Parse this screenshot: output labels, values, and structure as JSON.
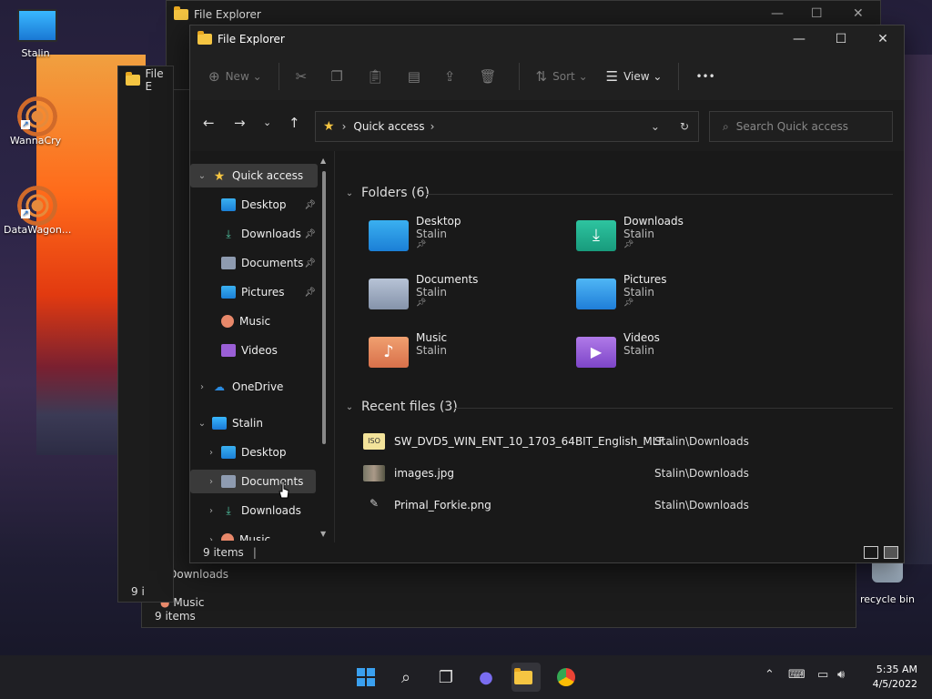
{
  "desktop": {
    "icons": [
      {
        "label": "Stalin"
      },
      {
        "label": "WannaCry"
      },
      {
        "label": "DataWagon..."
      },
      {
        "label": "recycle bin"
      }
    ]
  },
  "background_windows": {
    "title": "File Explorer",
    "title_short": "File E",
    "status": "9 items",
    "status_short": "9 i",
    "nav": [
      "Downloads",
      "Music"
    ]
  },
  "window": {
    "title": "File Explorer",
    "controls": {
      "minimize": "—",
      "maximize": "☐",
      "close": "✕"
    }
  },
  "commandbar": {
    "new": "New",
    "sort": "Sort",
    "view": "View",
    "more": "•••"
  },
  "address": {
    "location": "Quick access",
    "search_placeholder": "Search Quick access"
  },
  "sidebar": {
    "items": [
      {
        "label": "Quick access",
        "pinned": false
      },
      {
        "label": "Desktop",
        "pinned": true
      },
      {
        "label": "Downloads",
        "pinned": true
      },
      {
        "label": "Documents",
        "pinned": true
      },
      {
        "label": "Pictures",
        "pinned": true
      },
      {
        "label": "Music",
        "pinned": false
      },
      {
        "label": "Videos",
        "pinned": false
      },
      {
        "label": "OneDrive",
        "pinned": false
      },
      {
        "label": "Stalin",
        "pinned": false
      },
      {
        "label": "Desktop",
        "pinned": false
      },
      {
        "label": "Documents",
        "pinned": false
      },
      {
        "label": "Downloads",
        "pinned": false
      },
      {
        "label": "Music",
        "pinned": false
      }
    ]
  },
  "folders": {
    "heading": "Folders (6)",
    "items": [
      {
        "name": "Desktop",
        "owner": "Stalin",
        "pinned": true
      },
      {
        "name": "Downloads",
        "owner": "Stalin",
        "pinned": true
      },
      {
        "name": "Documents",
        "owner": "Stalin",
        "pinned": true
      },
      {
        "name": "Pictures",
        "owner": "Stalin",
        "pinned": true
      },
      {
        "name": "Music",
        "owner": "Stalin",
        "pinned": false
      },
      {
        "name": "Videos",
        "owner": "Stalin",
        "pinned": false
      }
    ]
  },
  "recent": {
    "heading": "Recent files (3)",
    "files": [
      {
        "name": "SW_DVD5_WIN_ENT_10_1703_64BIT_English_MLF...",
        "location": "Stalin\\Downloads"
      },
      {
        "name": "images.jpg",
        "location": "Stalin\\Downloads"
      },
      {
        "name": "Primal_Forkie.png",
        "location": "Stalin\\Downloads"
      }
    ]
  },
  "status": {
    "items": "9 items"
  },
  "taskbar": {
    "time": "5:35 AM",
    "date": "4/5/2022"
  },
  "colors": {
    "accent": "#f5c542",
    "window_bg": "#191919",
    "selected": "#3a3a3a"
  }
}
